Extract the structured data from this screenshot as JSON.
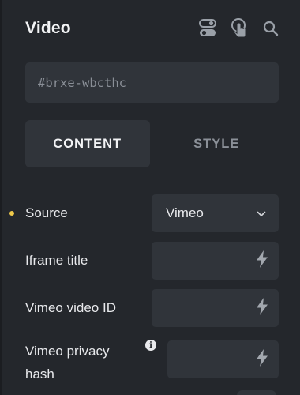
{
  "header": {
    "title": "Video",
    "icons": [
      "toggle-icon",
      "pointer-hand-icon",
      "search-icon"
    ]
  },
  "element_id": {
    "value": "#brxe-wbcthc"
  },
  "tabs": [
    {
      "label": "CONTENT",
      "active": true
    },
    {
      "label": "STYLE",
      "active": false
    }
  ],
  "fields": {
    "source": {
      "label": "Source",
      "value": "Vimeo",
      "modified": true
    },
    "iframe_title": {
      "label": "Iframe title",
      "value": ""
    },
    "vimeo_video_id": {
      "label": "Vimeo video ID",
      "value": ""
    },
    "vimeo_privacy_hash": {
      "label_line1": "Vimeo privacy",
      "label_line2": "hash",
      "value": ""
    }
  },
  "colors": {
    "background": "#24272c",
    "control": "#30343a",
    "modified_dot": "#f0c94a",
    "text": "#e8e9ec",
    "muted": "#8b9098"
  }
}
